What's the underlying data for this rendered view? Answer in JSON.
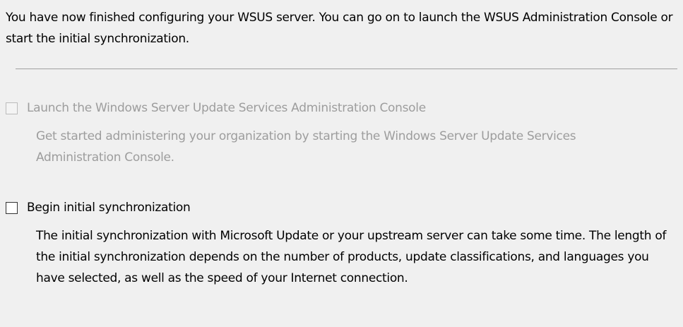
{
  "intro_text": "You have now finished configuring your WSUS server. You can go on to launch the WSUS Administration Console or start the initial synchronization.",
  "options": [
    {
      "label": "Launch the Windows Server Update Services Administration Console",
      "description": "Get started administering your organization by starting the Windows Server Update Services Administration Console.",
      "checked": false,
      "enabled": false
    },
    {
      "label": "Begin initial synchronization",
      "description": "The initial synchronization with Microsoft Update or your upstream server can take some time. The length of the initial synchronization depends on the number of products, update classifications, and languages you have selected, as well as the speed of your Internet connection.",
      "checked": false,
      "enabled": true
    }
  ]
}
